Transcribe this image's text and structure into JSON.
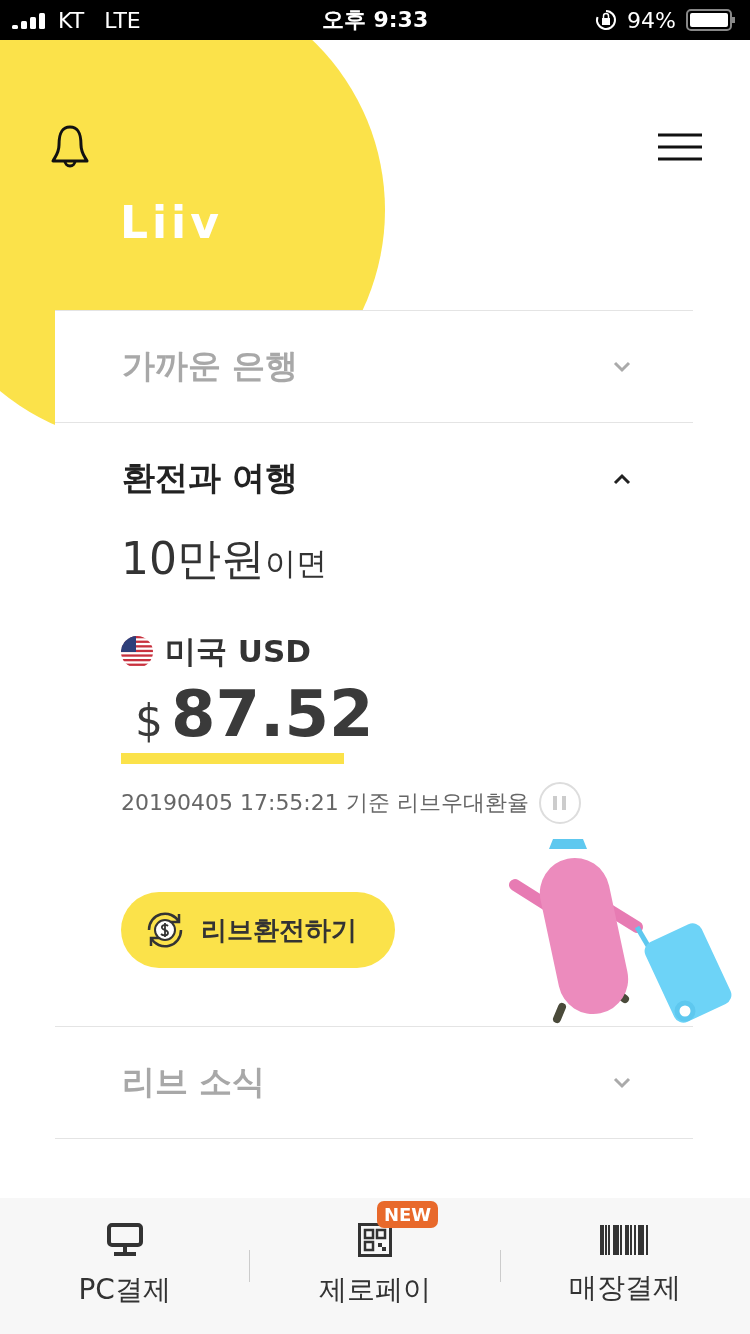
{
  "status_bar": {
    "carrier": "KT",
    "network": "LTE",
    "time": "오후 9:33",
    "battery": "94%"
  },
  "logo": "Liiv",
  "sections": [
    {
      "title": "가까운 은행",
      "expanded": false
    },
    {
      "title": "환전과 여행",
      "expanded": true,
      "content": {
        "base_amount": "10만원",
        "base_suffix": "이면",
        "country": "미국 USD",
        "currency_symbol": "$",
        "converted": "87.52",
        "rate_note": "20190405 17:55:21 기준 리브우대환율",
        "button": "리브환전하기"
      }
    },
    {
      "title": "리브 소식",
      "expanded": false
    }
  ],
  "bottom_nav": [
    {
      "kind": "monitor",
      "label": "PC결제"
    },
    {
      "kind": "qr",
      "label": "제로페이",
      "badge": "NEW"
    },
    {
      "kind": "barcode",
      "label": "매장결제"
    }
  ]
}
